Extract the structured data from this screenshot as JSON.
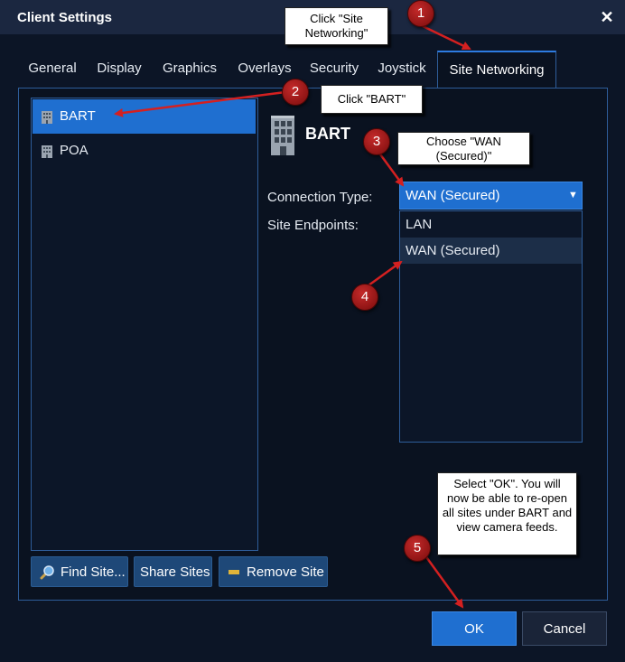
{
  "window": {
    "title": "Client Settings",
    "close_glyph": "✕"
  },
  "tabs": [
    {
      "label": "General",
      "active": false
    },
    {
      "label": "Display",
      "active": false
    },
    {
      "label": "Graphics",
      "active": false
    },
    {
      "label": "Overlays",
      "active": false
    },
    {
      "label": "Security",
      "active": false
    },
    {
      "label": "Joystick",
      "active": false
    },
    {
      "label": "Site Networking",
      "active": true
    }
  ],
  "sites": [
    {
      "label": "BART",
      "selected": true,
      "icon": "building-icon"
    },
    {
      "label": "POA",
      "selected": false,
      "icon": "building-icon"
    }
  ],
  "site_buttons": {
    "find": {
      "label": "Find Site...",
      "icon": "magnifier-icon"
    },
    "share": {
      "label": "Share Sites"
    },
    "remove": {
      "label": "Remove Site",
      "icon": "minus-icon"
    }
  },
  "detail": {
    "site_name": "BART",
    "connection_type_label": "Connection Type:",
    "connection_type_value": "WAN (Secured)",
    "site_endpoints_label": "Site Endpoints:",
    "options": [
      "LAN",
      "WAN (Secured)"
    ]
  },
  "footer": {
    "ok": "OK",
    "cancel": "Cancel"
  },
  "annotations": {
    "callouts": [
      "Click \"Site Networking\"",
      "Click \"BART\"",
      "Choose \"WAN (Secured)\"",
      "Select \"OK\". You will now be able to re-open all sites under BART and view camera feeds."
    ],
    "badges": [
      "1",
      "2",
      "3",
      "4",
      "5"
    ]
  },
  "colors": {
    "accent": "#1f6fd0",
    "background": "#0c1526",
    "panel_border": "#2e5d9a",
    "badge_red": "#b01e1e",
    "arrow_red": "#d42020"
  }
}
